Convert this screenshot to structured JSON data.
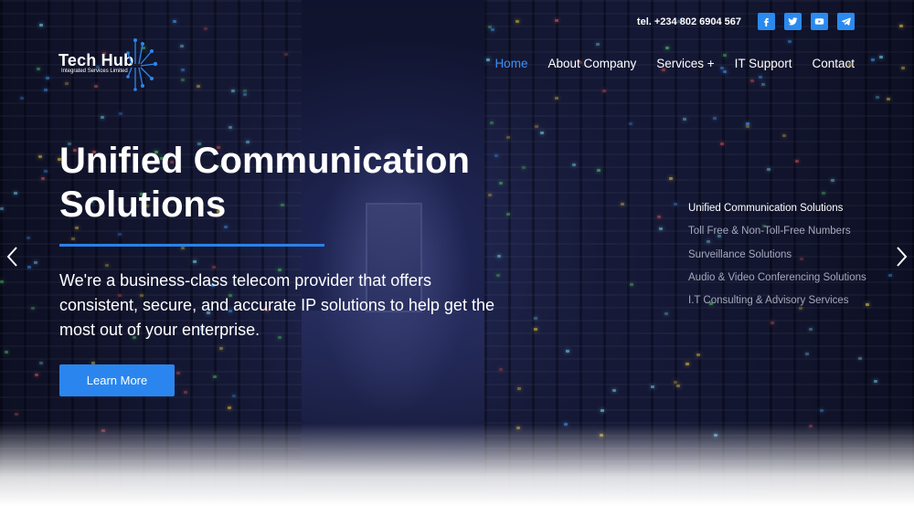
{
  "topbar": {
    "phone": "tel. +234 802 6904 567",
    "social": [
      {
        "icon": "facebook-icon"
      },
      {
        "icon": "twitter-icon"
      },
      {
        "icon": "youtube-icon"
      },
      {
        "icon": "telegram-icon"
      }
    ]
  },
  "logo": {
    "title": "Tech Hub",
    "subtitle": "Integrated Services Limited"
  },
  "nav": {
    "items": [
      "Home",
      "About Company",
      "Services +",
      "IT Support",
      "Contact"
    ],
    "active": "Home"
  },
  "hero": {
    "headline_line1": "Unified Communication",
    "headline_line2": "Solutions",
    "description": "We're a business-class telecom provider that offers consistent, secure, and accurate IP solutions to help get the most out of your enterprise.",
    "cta_label": "Learn More"
  },
  "slides": {
    "items": [
      "Unified Communication Solutions",
      "Toll Free & Non-Toll-Free Numbers",
      "Surveillance Solutions",
      "Audio & Video Conferencing Solutions",
      "I.T Consulting & Advisory Services"
    ],
    "current": "Unified Communication Solutions"
  },
  "colors": {
    "accent": "#2a86ee",
    "nav_active": "#3f8ff2",
    "background_dark": "#1a1f42"
  }
}
